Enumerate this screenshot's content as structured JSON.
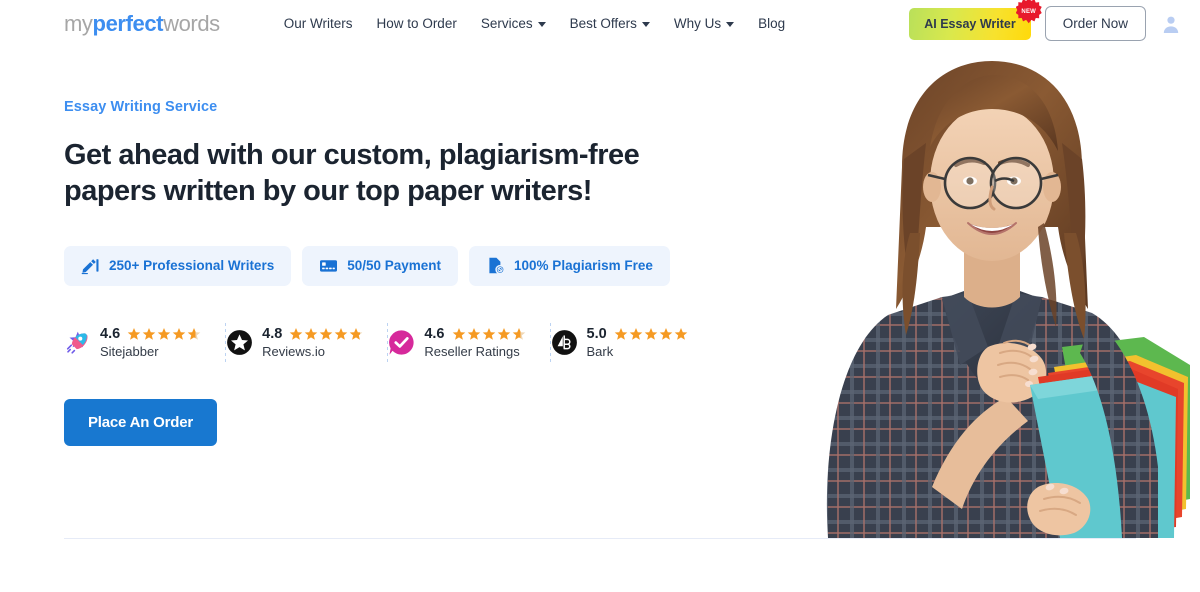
{
  "brand": {
    "logo_part1": "my",
    "logo_part2": "perfect",
    "logo_part3": "words",
    "accent_blue": "#3d8ef0",
    "cta_blue": "#1878d0",
    "star_orange": "#f59a23"
  },
  "nav": {
    "items": [
      {
        "label": "Our Writers",
        "has_dropdown": false
      },
      {
        "label": "How to Order",
        "has_dropdown": false
      },
      {
        "label": "Services",
        "has_dropdown": true
      },
      {
        "label": "Best Offers",
        "has_dropdown": true
      },
      {
        "label": "Why Us",
        "has_dropdown": true
      },
      {
        "label": "Blog",
        "has_dropdown": false
      }
    ]
  },
  "header_actions": {
    "ai_button_label": "AI Essay Writer",
    "ai_button_badge": "NEW",
    "order_button_label": "Order Now",
    "account_icon": "user-account-icon"
  },
  "hero": {
    "eyebrow": "Essay Writing Service",
    "headline": "Get ahead with our custom, plagiarism-free papers written by our top paper writers!",
    "cta_label": "Place An Order",
    "image_alt": "smiling-student-with-glasses-holding-folders"
  },
  "pills": [
    {
      "icon": "writing-hand-icon",
      "label": "250+ Professional Writers"
    },
    {
      "icon": "credit-card-icon",
      "label": "50/50 Payment"
    },
    {
      "icon": "document-blocked-icon",
      "label": "100% Plagiarism Free"
    }
  ],
  "ratings": [
    {
      "logo": "sitejabber-rocket-star-icon",
      "score": "4.6",
      "name": "Sitejabber",
      "stars": 4.6
    },
    {
      "logo": "reviewsio-black-star-icon",
      "score": "4.8",
      "name": "Reviews.io",
      "stars": 4.8
    },
    {
      "logo": "reseller-ratings-check-icon",
      "score": "4.6",
      "name": "Reseller Ratings",
      "stars": 4.6
    },
    {
      "logo": "bark-logo-icon",
      "score": "5.0",
      "name": "Bark",
      "stars": 5.0
    }
  ]
}
